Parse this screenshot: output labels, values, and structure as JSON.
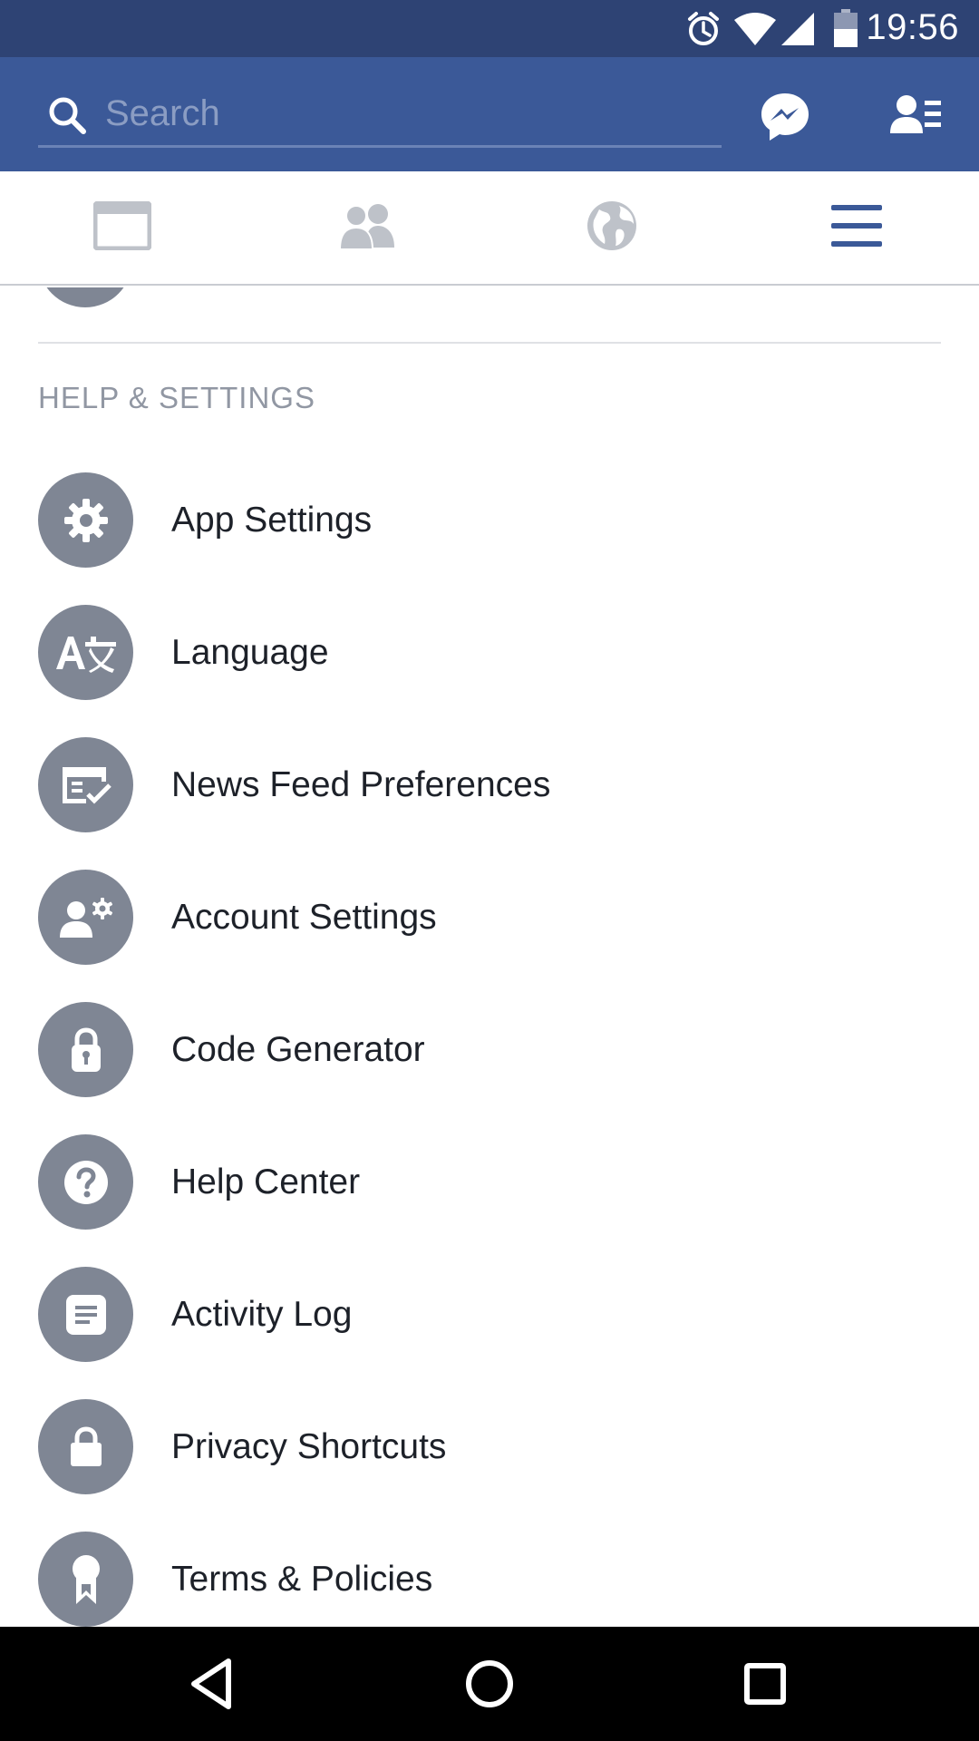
{
  "status_bar": {
    "time": "19:56",
    "icons": [
      "alarm-icon",
      "wifi-icon",
      "signal-icon",
      "battery-icon"
    ]
  },
  "header": {
    "search": {
      "placeholder": "Search",
      "value": ""
    },
    "icons": [
      "search-icon",
      "messenger-icon",
      "friend-requests-icon"
    ]
  },
  "tabs": [
    {
      "icon": "news-feed-icon",
      "active": false
    },
    {
      "icon": "friends-icon",
      "active": false
    },
    {
      "icon": "globe-icon",
      "active": false
    },
    {
      "icon": "menu-icon",
      "active": true
    }
  ],
  "section": {
    "title": "HELP & SETTINGS"
  },
  "menu_items": [
    {
      "icon": "gear-icon",
      "label": "App Settings"
    },
    {
      "icon": "language-icon",
      "label": "Language"
    },
    {
      "icon": "news-feed-preferences-icon",
      "label": "News Feed Preferences"
    },
    {
      "icon": "account-settings-icon",
      "label": "Account Settings"
    },
    {
      "icon": "code-generator-icon",
      "label": "Code Generator"
    },
    {
      "icon": "question-icon",
      "label": "Help Center"
    },
    {
      "icon": "activity-log-icon",
      "label": "Activity Log"
    },
    {
      "icon": "lock-icon",
      "label": "Privacy Shortcuts"
    },
    {
      "icon": "ribbon-icon",
      "label": "Terms & Policies"
    }
  ],
  "colors": {
    "status_bar": "#2e4374",
    "header": "#3b5998",
    "active_tab": "#3b5998",
    "inactive_tab": "#bec2c9",
    "menu_icon_bg": "#7f8694",
    "text": "#1d2129",
    "section_title": "#9197a3"
  },
  "nav_bar": {
    "buttons": [
      "back-icon",
      "home-icon",
      "recents-icon"
    ]
  }
}
